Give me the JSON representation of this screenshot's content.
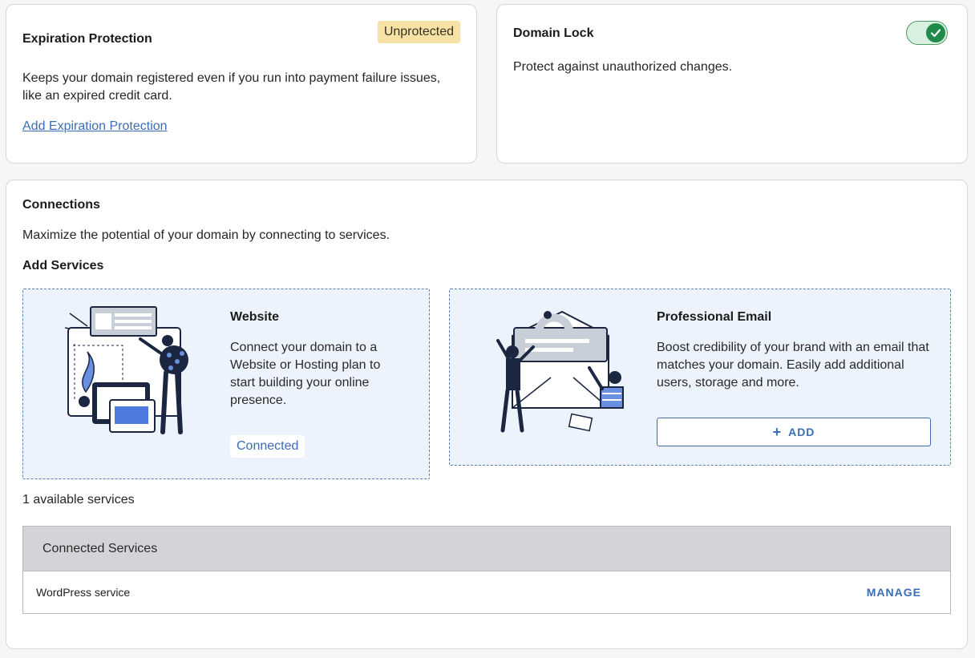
{
  "expiration": {
    "title": "Expiration Protection",
    "badge": "Unprotected",
    "description": "Keeps your domain registered even if you run into payment failure issues, like an expired credit card.",
    "link": "Add Expiration Protection"
  },
  "domain_lock": {
    "title": "Domain Lock",
    "description": "Protect against unauthorized changes.",
    "toggle_on": true
  },
  "connections": {
    "title": "Connections",
    "description": "Maximize the potential of your domain by connecting to services.",
    "add_services_title": "Add Services",
    "services": [
      {
        "title": "Website",
        "description": "Connect your domain to a Website or Hosting plan to start building your online presence.",
        "status": "Connected"
      },
      {
        "title": "Professional Email",
        "description": "Boost credibility of your brand with an email that matches your domain. Easily add additional users, storage and more.",
        "button": "ADD"
      }
    ],
    "available_count": "1 available services",
    "table": {
      "header": "Connected Services",
      "rows": [
        {
          "name": "WordPress service",
          "action": "MANAGE"
        }
      ]
    }
  },
  "colors": {
    "accent": "#3a6db5",
    "badge_bg": "#f6e1a6",
    "toggle_green": "#1f8a4a",
    "service_bg": "#edf3fc"
  }
}
